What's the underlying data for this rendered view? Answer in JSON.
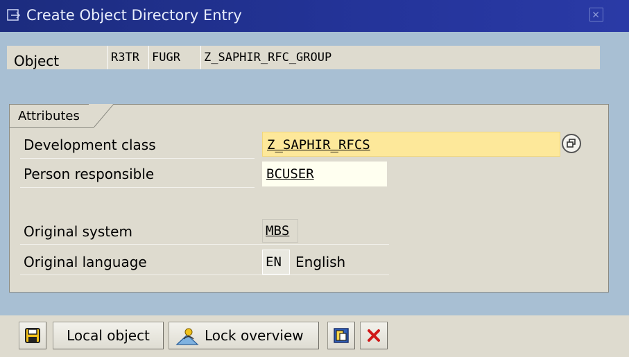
{
  "window": {
    "title": "Create Object Directory Entry",
    "icons": {
      "window": "dialog-arrow-icon",
      "close": "close-icon"
    }
  },
  "object": {
    "label": "Object",
    "pgmid": "R3TR",
    "type": "FUGR",
    "name": "Z_SAPHIR_RFC_GROUP"
  },
  "attributes": {
    "tab_label": "Attributes",
    "development_class": {
      "label": "Development class",
      "value": "Z_SAPHIR_RFCS",
      "help_icon": "possible-entries-icon"
    },
    "person_responsible": {
      "label": "Person responsible",
      "value": "BCUSER"
    },
    "original_system": {
      "label": "Original system",
      "value": "MBS"
    },
    "original_language": {
      "label": "Original language",
      "code": "EN",
      "text": "English"
    }
  },
  "toolbar": {
    "save_icon": "save-icon",
    "local_object_label": "Local object",
    "lock_overview_label": "Lock overview",
    "lock_overview_icon": "lock-overview-icon",
    "page_icon": "page-icon",
    "cancel_icon": "cancel-icon"
  },
  "colors": {
    "titlebar": "#24349a",
    "background": "#a8bfd3",
    "panel": "#dedbcf",
    "required_field": "#fde89a",
    "input_field": "#fffff0",
    "cancel_red": "#d01818"
  }
}
